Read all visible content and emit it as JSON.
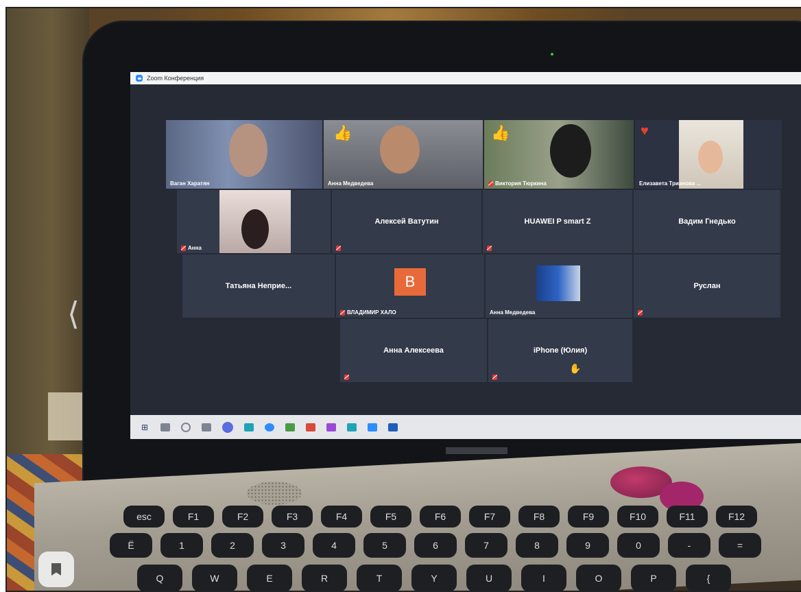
{
  "window": {
    "title": "Zoom Конференция"
  },
  "participants": [
    {
      "name": "Ваган Харатян",
      "muted": false,
      "video": true,
      "reaction": ""
    },
    {
      "name": "Анна Медведева",
      "muted": false,
      "video": true,
      "reaction": "thumbs-up",
      "active": true
    },
    {
      "name": "Виктория Тюркина",
      "muted": true,
      "video": true,
      "reaction": "thumbs-up"
    },
    {
      "name": "Елизавета Трианова ...",
      "muted": false,
      "video": true,
      "reaction": "heart"
    },
    {
      "name": "Анна",
      "muted": true,
      "video": true
    },
    {
      "name": "Алексей Ватутин",
      "muted": true,
      "video": false
    },
    {
      "name": "HUAWEI P smart Z",
      "muted": true,
      "video": false
    },
    {
      "name": "Вадим Гнедько",
      "muted": false,
      "video": false
    },
    {
      "name": "Татьяна Неприе...",
      "muted": false,
      "video": false
    },
    {
      "name": "ВЛАДИМИР ХАЛО",
      "muted": true,
      "video": false,
      "avatar_letter": "B",
      "avatar_color": "#e86a3a"
    },
    {
      "name": "Анна Медведева",
      "muted": false,
      "video": true
    },
    {
      "name": "Руслан",
      "muted": true,
      "video": false
    },
    {
      "name": "Анна Алексеева",
      "muted": true,
      "video": false
    },
    {
      "name": "iPhone (Юлия)",
      "muted": true,
      "video": false,
      "raised_hand": true
    }
  ],
  "keyboard": {
    "row1": [
      "esc",
      "F1",
      "F2",
      "F3",
      "F4",
      "F5",
      "F6",
      "F7",
      "F8",
      "F9",
      "F10",
      "F11",
      "F12"
    ],
    "row2": [
      "Ё",
      "1",
      "2",
      "3",
      "4",
      "5",
      "6",
      "7",
      "8",
      "9",
      "0",
      "-",
      "="
    ],
    "row3": [
      "Q",
      "W",
      "E",
      "R",
      "T",
      "Y",
      "U",
      "I",
      "O",
      "P",
      "{"
    ]
  },
  "colors": {
    "zoom_blue": "#2d8cff",
    "speaker_outline": "#b5e05a",
    "muted_red": "#e23a3a"
  },
  "icons": {
    "back": "chevron-left-icon",
    "bookmark": "bookmark-icon"
  }
}
